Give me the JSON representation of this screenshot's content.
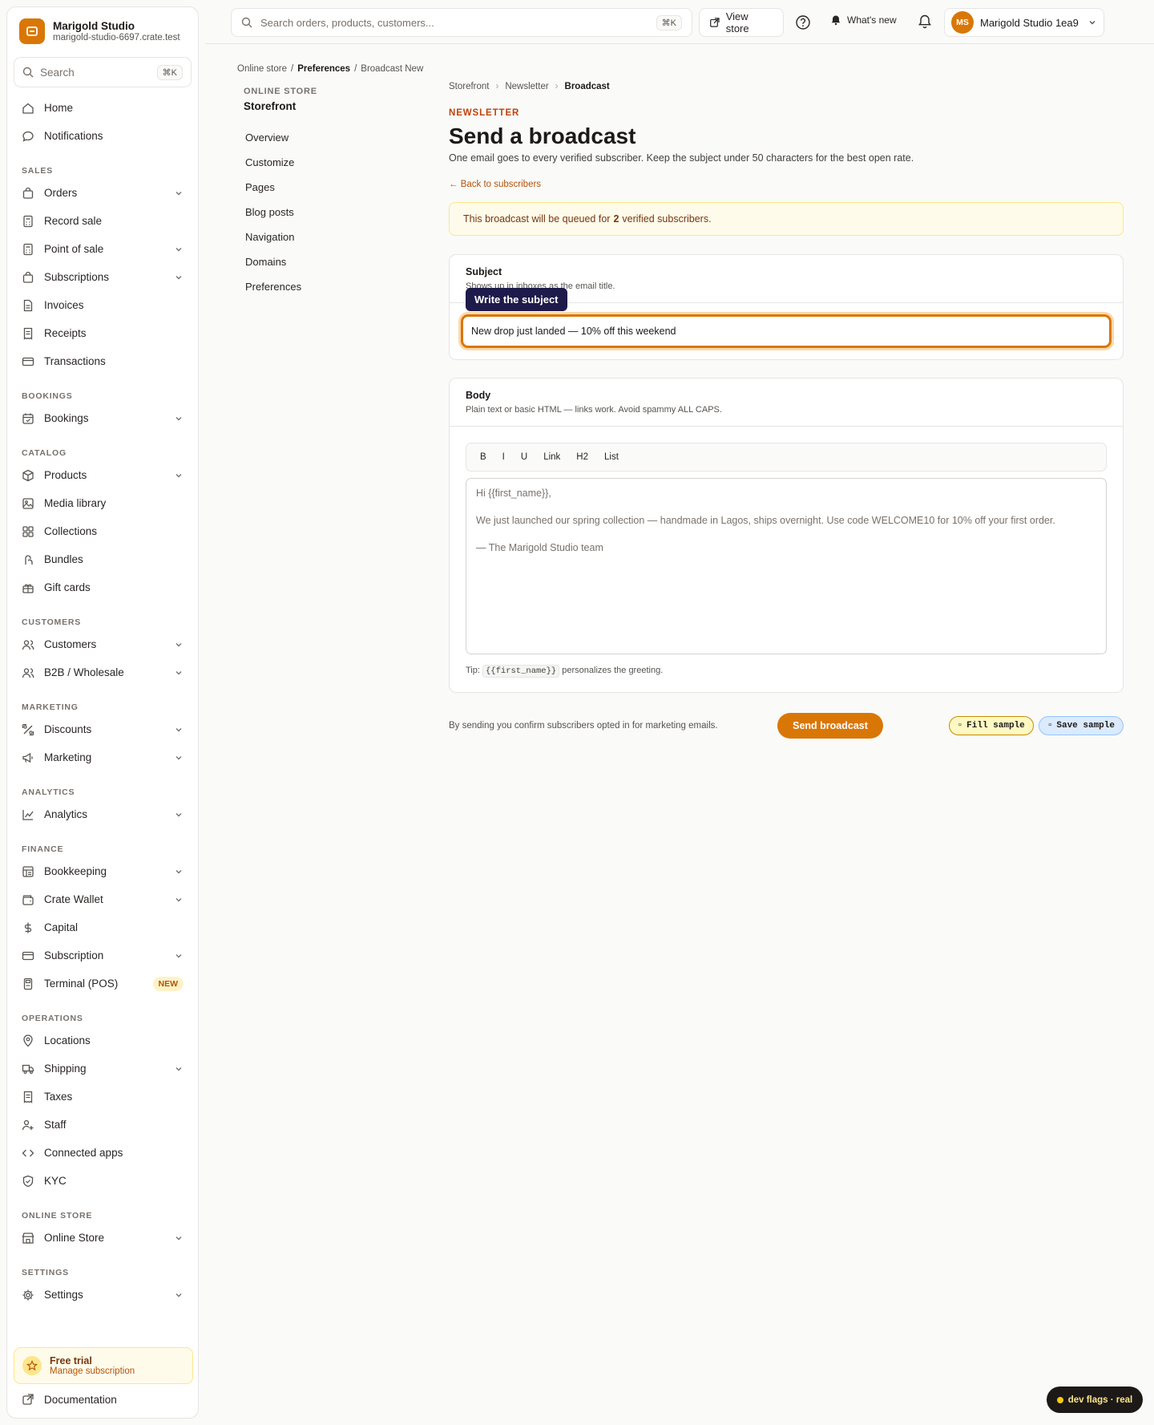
{
  "brand": {
    "name": "Marigold Studio",
    "domain": "marigold-studio-6697.crate.test"
  },
  "sidebar": {
    "search_placeholder": "Search",
    "search_shortcut": "⌘K",
    "top_items": [
      {
        "label": "Home",
        "icon": "home-icon"
      },
      {
        "label": "Notifications",
        "icon": "chat-bubble-icon"
      }
    ],
    "sections": [
      {
        "title": "SALES",
        "items": [
          {
            "label": "Orders",
            "icon": "bag-icon",
            "chevron": true
          },
          {
            "label": "Record sale",
            "icon": "calculator-icon",
            "chevron": false
          },
          {
            "label": "Point of sale",
            "icon": "calculator-icon",
            "chevron": true
          },
          {
            "label": "Subscriptions",
            "icon": "bag-icon",
            "chevron": true
          },
          {
            "label": "Invoices",
            "icon": "document-icon",
            "chevron": false
          },
          {
            "label": "Receipts",
            "icon": "receipt-icon",
            "chevron": false
          },
          {
            "label": "Transactions",
            "icon": "credit-card-icon",
            "chevron": false
          }
        ]
      },
      {
        "title": "BOOKINGS",
        "items": [
          {
            "label": "Bookings",
            "icon": "calendar-icon",
            "chevron": true
          }
        ]
      },
      {
        "title": "CATALOG",
        "items": [
          {
            "label": "Products",
            "icon": "box-icon",
            "chevron": true
          },
          {
            "label": "Media library",
            "icon": "image-icon",
            "chevron": false
          },
          {
            "label": "Collections",
            "icon": "grid-icon",
            "chevron": false
          },
          {
            "label": "Bundles",
            "icon": "bundle-icon",
            "chevron": false
          },
          {
            "label": "Gift cards",
            "icon": "gift-icon",
            "chevron": false
          }
        ]
      },
      {
        "title": "CUSTOMERS",
        "items": [
          {
            "label": "Customers",
            "icon": "users-icon",
            "chevron": true
          },
          {
            "label": "B2B / Wholesale",
            "icon": "users-icon",
            "chevron": true
          }
        ]
      },
      {
        "title": "MARKETING",
        "items": [
          {
            "label": "Discounts",
            "icon": "percent-icon",
            "chevron": true
          },
          {
            "label": "Marketing",
            "icon": "megaphone-icon",
            "chevron": true
          }
        ]
      },
      {
        "title": "ANALYTICS",
        "items": [
          {
            "label": "Analytics",
            "icon": "line-chart-icon",
            "chevron": true
          }
        ]
      },
      {
        "title": "FINANCE",
        "items": [
          {
            "label": "Bookkeeping",
            "icon": "ledger-icon",
            "chevron": true
          },
          {
            "label": "Crate Wallet",
            "icon": "wallet-icon",
            "chevron": true
          },
          {
            "label": "Capital",
            "icon": "dollar-icon",
            "chevron": false
          },
          {
            "label": "Subscription",
            "icon": "credit-card-icon",
            "chevron": true
          },
          {
            "label": "Terminal (POS)",
            "icon": "terminal-icon",
            "chevron": false,
            "badge": "NEW"
          }
        ]
      },
      {
        "title": "OPERATIONS",
        "items": [
          {
            "label": "Locations",
            "icon": "pin-icon",
            "chevron": false
          },
          {
            "label": "Shipping",
            "icon": "truck-icon",
            "chevron": true
          },
          {
            "label": "Taxes",
            "icon": "receipt-icon",
            "chevron": false
          },
          {
            "label": "Staff",
            "icon": "user-plus-icon",
            "chevron": false
          },
          {
            "label": "Connected apps",
            "icon": "code-icon",
            "chevron": false
          },
          {
            "label": "KYC",
            "icon": "shield-icon",
            "chevron": false
          }
        ]
      },
      {
        "title": "ONLINE STORE",
        "items": [
          {
            "label": "Online Store",
            "icon": "store-icon",
            "chevron": true
          }
        ]
      },
      {
        "title": "SETTINGS",
        "items": [
          {
            "label": "Settings",
            "icon": "gear-icon",
            "chevron": true
          }
        ]
      }
    ],
    "trial_title": "Free trial",
    "trial_sub": "Manage subscription",
    "docs_label": "Documentation"
  },
  "topbar": {
    "search_placeholder": "Search orders, products, customers...",
    "search_shortcut": "⌘K",
    "view_store": "View store",
    "whats_new": "What's new",
    "avatar_initials": "MS",
    "account_name": "Marigold Studio 1ea9"
  },
  "top_breadcrumb": {
    "first": "Online store",
    "second": "Preferences",
    "third": "Broadcast New"
  },
  "subnav": {
    "label": "ONLINE STORE",
    "title": "Storefront",
    "links": [
      "Overview",
      "Customize",
      "Pages",
      "Blog posts",
      "Navigation",
      "Domains",
      "Preferences"
    ]
  },
  "main": {
    "breadcrumb": [
      "Storefront",
      "Newsletter",
      "Broadcast"
    ],
    "eyebrow": "NEWSLETTER",
    "title": "Send a broadcast",
    "subtitle": "One email goes to every verified subscriber. Keep the subject under 50 characters for the best open rate.",
    "back_link": "← Back to subscribers",
    "notice_pre": "This broadcast will be queued for",
    "notice_count": "2",
    "notice_post": "verified subscribers.",
    "subject": {
      "label": "Subject",
      "desc": "Shows up in inboxes as the email title.",
      "tooltip": "Write the subject",
      "value": "New drop just landed — 10% off this weekend"
    },
    "body": {
      "label": "Body",
      "desc": "Plain text or basic HTML — links work. Avoid spammy ALL CAPS.",
      "toolbar": [
        "B",
        "I",
        "U",
        "Link",
        "H2",
        "List"
      ],
      "lines": [
        "Hi {{first_name}},",
        "We just launched our spring collection — handmade in Lagos, ships overnight. Use code WELCOME10 for 10% off your first order.",
        "— The Marigold Studio team"
      ],
      "tip_pre": "Tip:",
      "tip_code": "{{first_name}}",
      "tip_post": "personalizes the greeting."
    },
    "consent": "By sending you confirm subscribers opted in for marketing emails.",
    "send_button": "Send broadcast",
    "fill_sample": "Fill sample",
    "save_sample": "Save sample"
  },
  "dev_flags": "dev flags · real",
  "colors": {
    "accent": "#d97706",
    "accent_dark": "#c2410c",
    "notice_bg": "#fffbeb",
    "tooltip_bg": "#1e1b4b"
  }
}
